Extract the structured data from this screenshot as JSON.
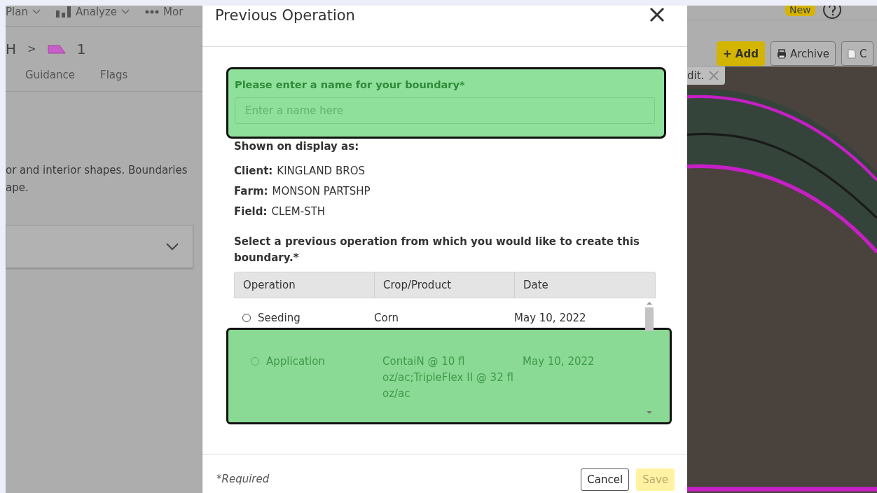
{
  "left": {
    "nav": [
      {
        "label": "Plan",
        "kind": "plain",
        "caret": true
      },
      {
        "label": "Analyze",
        "kind": "chart",
        "caret": true
      },
      {
        "label": "Mor",
        "kind": "dots",
        "caret": false
      }
    ],
    "breadcrumb": {
      "parent": "H",
      "separator": ">",
      "current": "1"
    },
    "tabs": [
      {
        "label": "Guidance",
        "selected": false
      },
      {
        "label": "Flags",
        "selected": false
      }
    ],
    "description": "or and interior shapes. Boundaries\nape.",
    "dropdown": {
      "expanded": false
    }
  },
  "dialog": {
    "title": "Previous Operation",
    "name_section": {
      "highlighted": true,
      "label": "Please enter a name for your boundary*",
      "placeholder": "Enter a name here"
    },
    "shown_as": "Shown on display as:",
    "details": [
      {
        "label": "Client:",
        "value": "KINGLAND BROS"
      },
      {
        "label": "Farm:",
        "value": "MONSON PARTSHP"
      },
      {
        "label": "Field:",
        "value": "CLEM-STH"
      }
    ],
    "question": "Select a previous operation from which you would like to create this boundary.*",
    "table": {
      "columns": [
        "Operation",
        "Crop/Product",
        "Date"
      ],
      "rows": [
        {
          "operation": "Seeding",
          "product": "Corn",
          "date": "May 10, 2022",
          "checked": false,
          "highlighted": false
        },
        {
          "operation": "Application",
          "product": "ContaiN @ 10 fl oz/ac;TripleFlex II @ 32 fl oz/ac",
          "date": "May 10, 2022",
          "checked": false,
          "highlighted": true
        }
      ]
    },
    "required_note": "*Required",
    "buttons": [
      {
        "label": "Cancel",
        "kind": "secondary",
        "disabled": false
      },
      {
        "label": "Save",
        "kind": "primary",
        "disabled": true
      }
    ]
  },
  "right": {
    "badge": "New",
    "toolbar": [
      {
        "label": "+ Add",
        "kind": "primary"
      },
      {
        "label": "Archive",
        "kind": "archive"
      },
      {
        "label": "C",
        "kind": "copy"
      }
    ],
    "tooltip": "dit."
  }
}
